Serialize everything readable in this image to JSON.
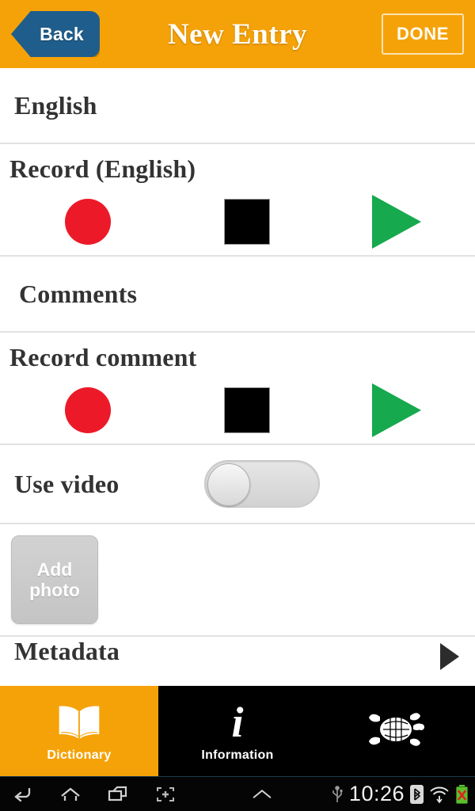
{
  "header": {
    "back_label": "Back",
    "title": "New Entry",
    "done_label": "DONE",
    "bg_color": "#F5A208",
    "back_color": "#1F5E8C"
  },
  "list": {
    "rows": [
      {
        "label": "English",
        "type": "text"
      },
      {
        "label": "Record (English)",
        "type": "recorder"
      },
      {
        "label": "Comments",
        "type": "text"
      },
      {
        "label": "Record comment",
        "type": "recorder"
      },
      {
        "label": "Use video",
        "type": "toggle",
        "value": "off"
      },
      {
        "label": "Add photo",
        "type": "photo"
      },
      {
        "label": "Metadata",
        "type": "disclosure"
      }
    ],
    "recorder_controls": [
      {
        "name": "record",
        "color": "#EC1A28"
      },
      {
        "name": "stop",
        "color": "#000000"
      },
      {
        "name": "play",
        "color": "#16A94E"
      }
    ],
    "add_photo_line1": "Add",
    "add_photo_line2": "photo"
  },
  "tabbar": {
    "tabs": [
      {
        "label": "Dictionary",
        "icon": "open-book-icon",
        "active": true
      },
      {
        "label": "Information",
        "icon": "info-i-icon",
        "active": false
      },
      {
        "label": "",
        "icon": "turtle-icon",
        "active": false
      }
    ],
    "active_color": "#F5A208"
  },
  "system": {
    "nav": [
      {
        "icon": "back-arrow-icon"
      },
      {
        "icon": "home-icon"
      },
      {
        "icon": "recents-icon"
      },
      {
        "icon": "screenshot-icon"
      },
      {
        "icon": "chevron-up-icon"
      }
    ],
    "usb_icon": "usb-icon",
    "clock": "10:26",
    "bluetooth_icon": "bluetooth-icon",
    "wifi_icon": "wifi-icon",
    "battery_icon": "battery-error-icon"
  }
}
